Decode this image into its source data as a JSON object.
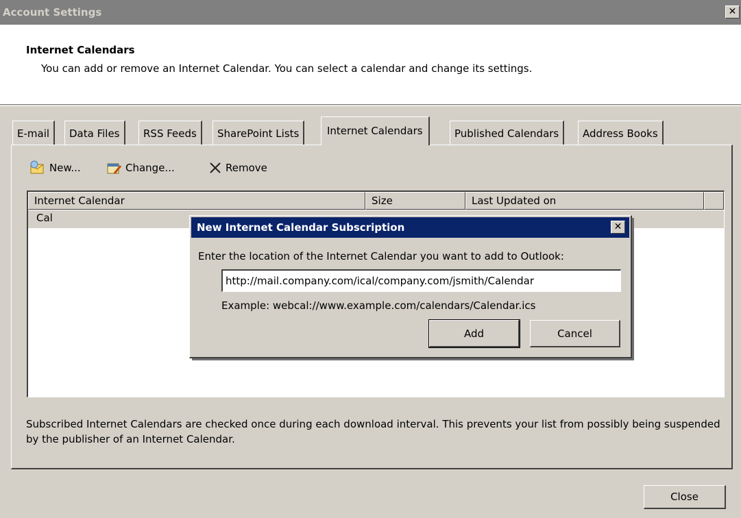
{
  "window": {
    "title": "Account Settings",
    "close_icon": "close-icon"
  },
  "header": {
    "title": "Internet Calendars",
    "description": "You can add or remove an Internet Calendar. You can select a calendar and change its settings."
  },
  "tabs": [
    {
      "label": "E-mail",
      "active": false
    },
    {
      "label": "Data Files",
      "active": false
    },
    {
      "label": "RSS Feeds",
      "active": false
    },
    {
      "label": "SharePoint Lists",
      "active": false
    },
    {
      "label": "Internet Calendars",
      "active": true
    },
    {
      "label": "Published Calendars",
      "active": false
    },
    {
      "label": "Address Books",
      "active": false
    }
  ],
  "toolbar": {
    "new_label": "New...",
    "change_label": "Change...",
    "remove_label": "Remove",
    "new_icon": "new-calendar-icon",
    "change_icon": "change-calendar-icon",
    "remove_icon": "remove-x-icon"
  },
  "list": {
    "columns": [
      "Internet Calendar",
      "Size",
      "Last Updated on"
    ],
    "rows": [
      {
        "name": "Cal",
        "size": "",
        "updated": ""
      }
    ]
  },
  "footnote": "Subscribed Internet Calendars are checked once during each download interval. This prevents your list from possibly being suspended by the publisher of an Internet Calendar.",
  "close_button": "Close",
  "dialog": {
    "title": "New Internet Calendar Subscription",
    "prompt": "Enter the location of the Internet Calendar you want to add to Outlook:",
    "url_value": "http://mail.company.com/ical/company.com/jsmith/Calendar",
    "example": "Example: webcal://www.example.com/calendars/Calendar.ics",
    "add_label": "Add",
    "cancel_label": "Cancel"
  },
  "colors": {
    "face": "#d4d0c8",
    "title_inactive": "#808080",
    "title_active": "#0a246a"
  }
}
